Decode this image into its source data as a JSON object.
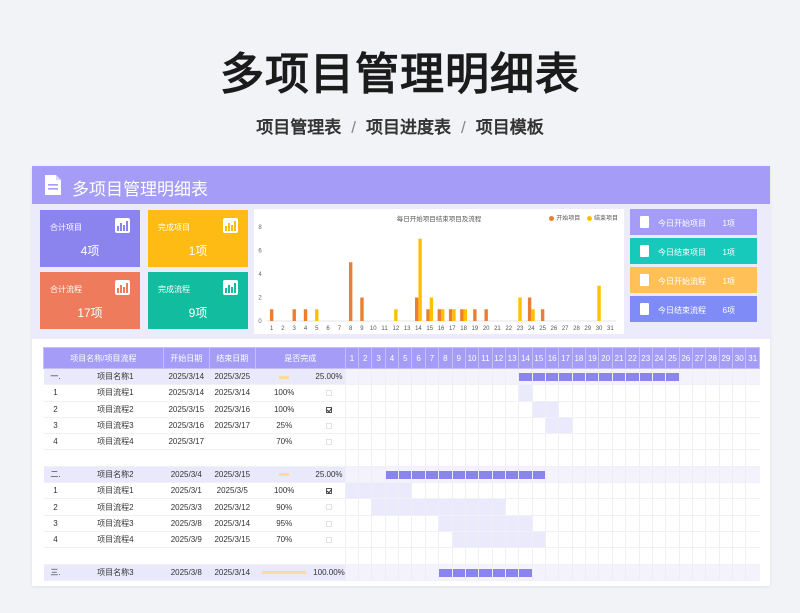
{
  "page": {
    "title": "多项目管理明细表",
    "nav": [
      "项目管理表",
      "项目进度表",
      "项目模板"
    ],
    "nav_sep": "/"
  },
  "banner": {
    "title": "多项目管理明细表"
  },
  "tiles": [
    {
      "label": "合计项目",
      "value": "4项",
      "color": "#8c84ee",
      "icon": "bar-chart-icon"
    },
    {
      "label": "完成项目",
      "value": "1项",
      "color": "#fdbb14",
      "icon": "bar-chart-icon"
    },
    {
      "label": "合计流程",
      "value": "17项",
      "color": "#ee7b5b",
      "icon": "bar-chart-icon"
    },
    {
      "label": "完成流程",
      "value": "9项",
      "color": "#12bd9f",
      "icon": "bar-chart-icon"
    }
  ],
  "right_list": [
    {
      "label": "今日开始项目",
      "value": "1项",
      "color": "#a49cf7"
    },
    {
      "label": "今日结束项目",
      "value": "1项",
      "color": "#16c9ba"
    },
    {
      "label": "今日开始流程",
      "value": "1项",
      "color": "#ffc057"
    },
    {
      "label": "今日结束流程",
      "value": "6项",
      "color": "#7f8cf7"
    }
  ],
  "chart_data": {
    "type": "bar",
    "title": "每日开始项目结束项目及流程",
    "categories": [
      "1",
      "2",
      "3",
      "4",
      "5",
      "6",
      "7",
      "8",
      "9",
      "10",
      "11",
      "12",
      "13",
      "14",
      "15",
      "16",
      "17",
      "18",
      "19",
      "20",
      "21",
      "22",
      "23",
      "24",
      "25",
      "26",
      "27",
      "28",
      "29",
      "30",
      "31"
    ],
    "ylim": [
      0,
      8
    ],
    "yticks": [
      0,
      2,
      4,
      6,
      8
    ],
    "series": [
      {
        "name": "开始项目",
        "color": "#ed7d31",
        "values": [
          1,
          0,
          1,
          1,
          0,
          0,
          0,
          5,
          2,
          0,
          0,
          0,
          0,
          2,
          1,
          1,
          1,
          1,
          1,
          1,
          0,
          0,
          0,
          2,
          1,
          0,
          0,
          0,
          0,
          0,
          0
        ]
      },
      {
        "name": "结束项目",
        "color": "#ffc000",
        "values": [
          0,
          0,
          0,
          0,
          1,
          0,
          0,
          0,
          0,
          0,
          0,
          1,
          0,
          7,
          2,
          1,
          1,
          1,
          0,
          0,
          0,
          0,
          2,
          1,
          0,
          0,
          0,
          0,
          0,
          3,
          0
        ]
      }
    ],
    "legend": "top-right",
    "grid": false
  },
  "table": {
    "headers": [
      "项目名称/项目流程",
      "开始日期",
      "结束日期",
      "是否完成"
    ],
    "days": [
      "1",
      "2",
      "3",
      "4",
      "5",
      "6",
      "7",
      "8",
      "9",
      "10",
      "11",
      "12",
      "13",
      "14",
      "15",
      "16",
      "17",
      "18",
      "19",
      "20",
      "21",
      "22",
      "23",
      "24",
      "25",
      "26",
      "27",
      "28",
      "29",
      "30",
      "31"
    ],
    "rows": [
      {
        "type": "group",
        "no": "一.",
        "name": "项目名称1",
        "start": "2025/3/14",
        "end": "2025/3/25",
        "done": "25.00%",
        "progress": 0.25,
        "bar": [
          14,
          25
        ]
      },
      {
        "type": "item",
        "no": "1",
        "name": "项目流程1",
        "start": "2025/3/14",
        "end": "2025/3/14",
        "done": "100%",
        "checked": false,
        "bar": [
          14,
          14
        ]
      },
      {
        "type": "item",
        "no": "2",
        "name": "项目流程2",
        "start": "2025/3/15",
        "end": "2025/3/16",
        "done": "100%",
        "checked": true,
        "bar": [
          15,
          16
        ]
      },
      {
        "type": "item",
        "no": "3",
        "name": "项目流程3",
        "start": "2025/3/16",
        "end": "2025/3/17",
        "done": "25%",
        "checked": false,
        "bar": [
          16,
          17
        ]
      },
      {
        "type": "item",
        "no": "4",
        "name": "项目流程4",
        "start": "2025/3/17",
        "end": "",
        "done": "70%",
        "checked": false,
        "bar": null
      },
      {
        "type": "blank"
      },
      {
        "type": "group",
        "no": "二.",
        "name": "项目名称2",
        "start": "2025/3/4",
        "end": "2025/3/15",
        "done": "25.00%",
        "progress": 0.25,
        "bar": [
          4,
          15
        ]
      },
      {
        "type": "item",
        "no": "1",
        "name": "项目流程1",
        "start": "2025/3/1",
        "end": "2025/3/5",
        "done": "100%",
        "checked": true,
        "bar": [
          1,
          5
        ]
      },
      {
        "type": "item",
        "no": "2",
        "name": "项目流程2",
        "start": "2025/3/3",
        "end": "2025/3/12",
        "done": "90%",
        "checked": false,
        "bar": [
          3,
          12
        ]
      },
      {
        "type": "item",
        "no": "3",
        "name": "项目流程3",
        "start": "2025/3/8",
        "end": "2025/3/14",
        "done": "95%",
        "checked": false,
        "bar": [
          8,
          14
        ]
      },
      {
        "type": "item",
        "no": "4",
        "name": "项目流程4",
        "start": "2025/3/9",
        "end": "2025/3/15",
        "done": "70%",
        "checked": false,
        "bar": [
          9,
          15
        ]
      },
      {
        "type": "blank"
      },
      {
        "type": "group",
        "no": "三.",
        "name": "项目名称3",
        "start": "2025/3/8",
        "end": "2025/3/14",
        "done": "100.00%",
        "progress": 1.0,
        "bar": [
          8,
          14
        ]
      }
    ]
  }
}
